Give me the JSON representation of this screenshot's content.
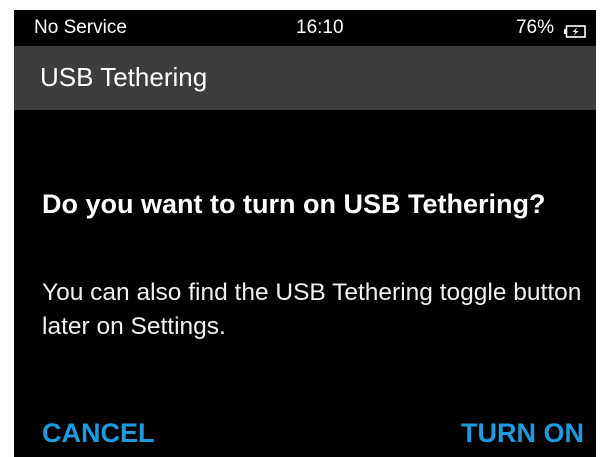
{
  "status_bar": {
    "carrier": "No Service",
    "time": "16:10",
    "battery": "76%",
    "battery_icon": "battery-charging-icon"
  },
  "title_bar": {
    "title": "USB Tethering"
  },
  "dialog": {
    "question": "Do you want to turn on USB Tethering?",
    "body": "You can also find the USB Tethering toggle button later on Settings.",
    "cancel_label": "CANCEL",
    "confirm_label": "TURN ON"
  },
  "colors": {
    "background": "#000000",
    "title_bar": "#3d3d3d",
    "accent": "#1e9be0",
    "text": "#ffffff"
  }
}
